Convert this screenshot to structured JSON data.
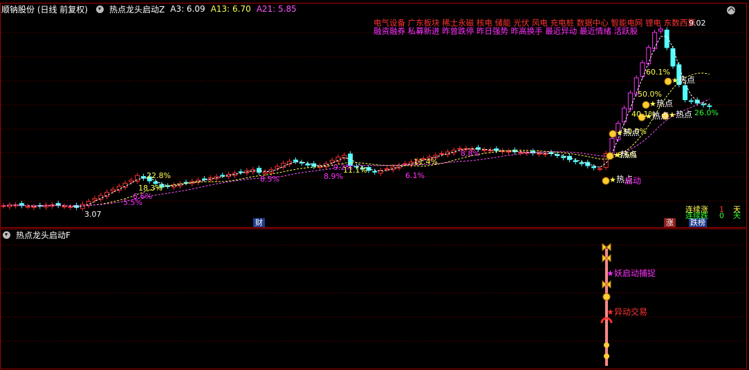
{
  "header": {
    "stock": "顺钠股份 (日线 前复权)",
    "indicator": "热点龙头启动Z",
    "a3": "A3: 6.09",
    "a13": "A13: 6.70",
    "a21": "A21: 5.85"
  },
  "sub_header": {
    "indicator": "热点龙头启动F"
  },
  "concepts_line1": "电气设备 广东板块 稀土永磁 核电 储能 光伏 风电 充电桩 数据中心 智能电网 锂电 东数西算",
  "concepts_line2": "融资融券 私募新进 昨曾跌停 昨日强势 昨高换手 最近异动 最近情绪 活跃股",
  "price_max": "9.02",
  "price_min": "3.07",
  "badges": {
    "cai": "财",
    "zhang": "涨",
    "dieting": "跌榜"
  },
  "streaks": {
    "up_label": "连续涨",
    "up_count": "1",
    "up_unit": "天",
    "down_label": "连续跌",
    "down_count": "0",
    "down_unit": "天"
  },
  "pct_labels": [
    "22.8%",
    "18.3%",
    "6.6%",
    "5.5%",
    "8.5%",
    "9.2%",
    "8.9%",
    "11.1%",
    "6.1%",
    "11.4%",
    "8.8%",
    "8.6%",
    "30.0%",
    "40.1%",
    "50.0%",
    "60.1%",
    "26.0%"
  ],
  "hot_label": "热点",
  "start_label": "启动",
  "sub_labels": {
    "catch": "妖启动捕捉",
    "abnormal": "异动交易"
  },
  "colors": {
    "up": "#ff3232",
    "down": "#54ffff",
    "special": "#ff32ff",
    "ma_white": "#ffffff",
    "ma_yellow": "#ffff54",
    "ma_magenta": "#ff54ff",
    "grid": "#8b0000",
    "border": "#aa0000"
  },
  "icons": [
    "coin-icon",
    "star-icon",
    "butterfly-icon",
    "rainbow-icon",
    "ball-icon",
    "chevron-down-icon",
    "window-control-icon"
  ]
}
